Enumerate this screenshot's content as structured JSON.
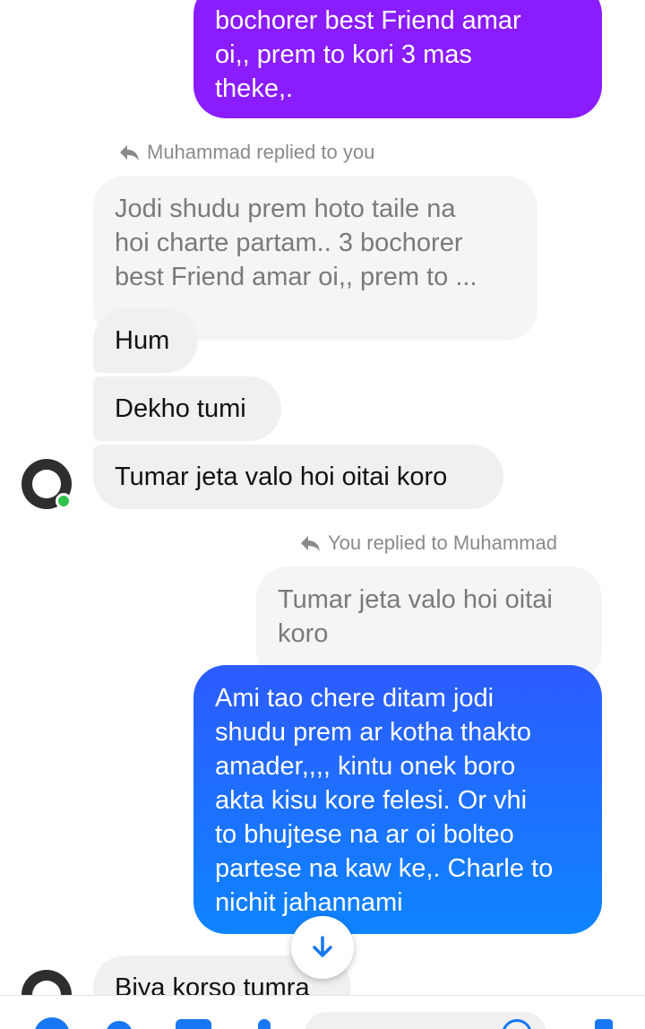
{
  "messages": {
    "top_sent": {
      "lines": [
        "bochorer best Friend amar",
        "oi,, prem to kori 3 mas",
        "theke,."
      ]
    },
    "reply1": {
      "label": "Muhammad replied to you",
      "quoted_lines": [
        "Jodi shudu prem hoto taile na",
        "hoi charte partam.. 3 bochorer",
        "best Friend amar oi,, prem to ..."
      ]
    },
    "recv_hum": "Hum",
    "recv_dekho": "Dekho tumi",
    "recv_tumar": "Tumar jeta valo hoi oitai koro",
    "reply2": {
      "label": "You replied to Muhammad",
      "quoted_lines": [
        "Tumar jeta valo hoi oitai",
        "koro"
      ]
    },
    "sent_main": {
      "lines": [
        "Ami tao chere ditam jodi",
        "shudu prem ar kotha thakto",
        "amader,,,,  kintu onek boro",
        "akta kisu kore felesi.  Or vhi",
        "to bhujtese na ar oi bolteo",
        "partese na kaw ke,. Charle to",
        "nichit jahannami"
      ]
    },
    "recv_biya": "Biya korso tumra"
  },
  "contact": {
    "avatar_text": ""
  },
  "colors": {
    "sent_top": "#8a1cff",
    "sent_gradient_start": "#2d5bff",
    "sent_gradient_end": "#0e84ff",
    "accent": "#1877f2",
    "online": "#31c24d"
  },
  "icons": {
    "reply": "reply-arrow-icon",
    "scroll": "arrow-down-icon"
  }
}
